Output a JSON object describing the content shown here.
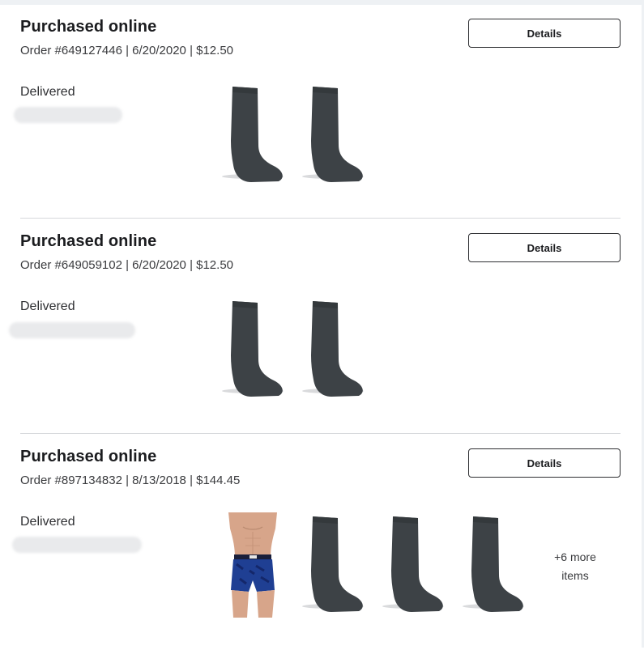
{
  "orders": [
    {
      "title": "Purchased online",
      "meta": "Order #649127446 | 6/20/2020 | $12.50",
      "details_label": "Details",
      "status": "Delivered",
      "items": [
        "sock-image",
        "sock-image"
      ]
    },
    {
      "title": "Purchased online",
      "meta": "Order #649059102 | 6/20/2020 | $12.50",
      "details_label": "Details",
      "status": "Delivered",
      "items": [
        "sock-image",
        "sock-image"
      ]
    },
    {
      "title": "Purchased online",
      "meta": "Order #897134832 | 8/13/2018 | $144.45",
      "details_label": "Details",
      "status": "Delivered",
      "items": [
        "boxer-briefs-image",
        "sock-image",
        "sock-image",
        "sock-image"
      ],
      "more_line1": "+6 more",
      "more_line2": "items"
    }
  ],
  "colors": {
    "sock": "#3d4246",
    "sock_shadow": "#c9cbcd",
    "boxer": "#1f3f93",
    "skin": "#d7a58a",
    "divider": "#d6d8dc"
  }
}
